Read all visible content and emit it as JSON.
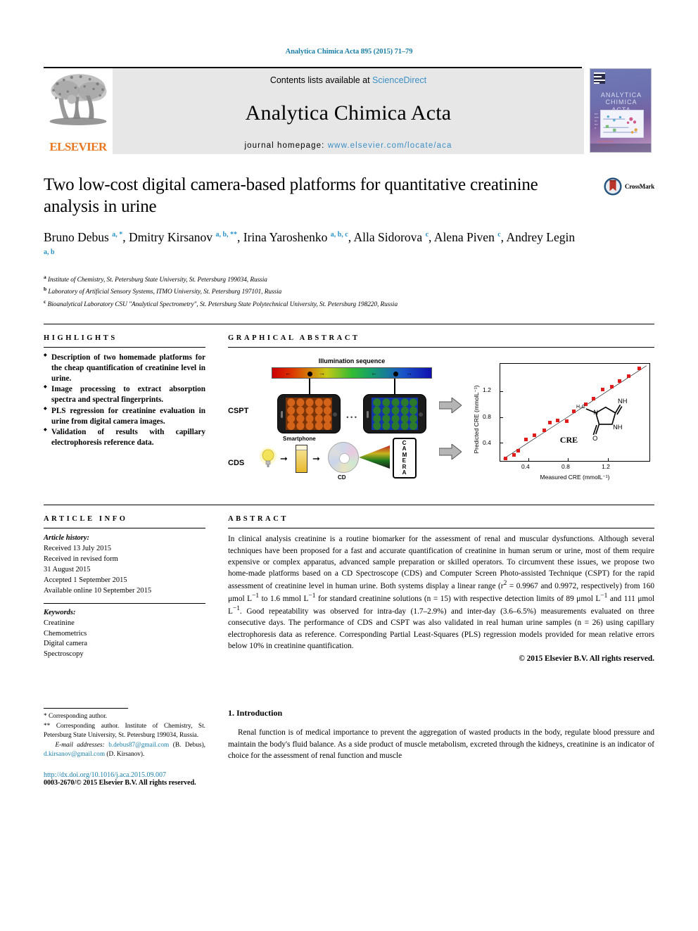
{
  "running_head": "Analytica Chimica Acta 895 (2015) 71–79",
  "masthead": {
    "contents_prefix": "Contents lists available at ",
    "sciencedirect": "ScienceDirect",
    "journal_name": "Analytica Chimica Acta",
    "homepage_prefix": "journal homepage: ",
    "homepage_url": "www.elsevier.com/locate/aca",
    "publisher": "ELSEVIER",
    "cover_title": "ANALYTICA CHIMICA ACTA",
    "accent_link_color": "#3c8fc4",
    "publisher_color": "#E87722"
  },
  "article": {
    "title": "Two low-cost digital camera-based platforms for quantitative creatinine analysis in urine",
    "crossmark_label": "CrossMark",
    "authors_html": "Bruno Debus <sup>a, *</sup>, Dmitry Kirsanov <sup>a, b, **</sup>, Irina Yaroshenko <sup>a, b, c</sup>, Alla Sidorova <sup>c</sup>, Alena Piven <sup>c</sup>, Andrey Legin <sup>a, b</sup>",
    "affiliations": [
      {
        "marker": "a",
        "text": "Institute of Chemistry, St. Petersburg State University, St. Petersburg 199034, Russia"
      },
      {
        "marker": "b",
        "text": "Laboratory of Artificial Sensory Systems, ITMO University, St. Petersburg 197101, Russia"
      },
      {
        "marker": "c",
        "text": "Bioanalytical Laboratory CSU \"Analytical Spectrometry\", St. Petersburg State Polytechnical University, St. Petersburg 198220, Russia"
      }
    ]
  },
  "highlights": {
    "heading": "HIGHLIGHTS",
    "items": [
      "Description of two homemade platforms for the cheap quantification of creatinine level in urine.",
      "Image processing to extract absorption spectra and spectral fingerprints.",
      "PLS regression for creatinine evaluation in urine from digital camera images.",
      "Validation of results with capillary electrophoresis reference data."
    ]
  },
  "graphical_abstract": {
    "heading": "GRAPHICAL ABSTRACT",
    "illumination_label": "Illumination sequence",
    "row_labels": {
      "cspt": "CSPT",
      "cds": "CDS"
    },
    "smartphone_caption": "Smartphone",
    "cd_caption": "CD",
    "camera_label": "CAMERA",
    "ellipsis": "...",
    "molecule_label": "CRE",
    "molecule_atoms": [
      "H₃C",
      "N",
      "NH",
      "NH",
      "O"
    ]
  },
  "chart_data": {
    "type": "scatter",
    "title": "",
    "xlabel": "Measured CRE (mmolL⁻¹)",
    "ylabel": "Predicted CRE (mmolL⁻¹)",
    "xticks": [
      0.4,
      0.8,
      1.2
    ],
    "yticks": [
      0.4,
      0.8,
      1.2
    ],
    "xlim": [
      0.12,
      1.62
    ],
    "ylim": [
      0.12,
      1.62
    ],
    "grid": false,
    "legend": "none",
    "marker_color": "#e01b1b",
    "line_color": "#000000",
    "fit_line": {
      "slope": 1.0,
      "intercept": 0.0
    },
    "points": [
      [
        0.17,
        0.16
      ],
      [
        0.26,
        0.22
      ],
      [
        0.3,
        0.28
      ],
      [
        0.38,
        0.45
      ],
      [
        0.46,
        0.52
      ],
      [
        0.56,
        0.6
      ],
      [
        0.62,
        0.72
      ],
      [
        0.7,
        0.75
      ],
      [
        0.79,
        0.74
      ],
      [
        0.86,
        0.89
      ],
      [
        0.98,
        1.0
      ],
      [
        1.06,
        1.09
      ],
      [
        1.15,
        1.23
      ],
      [
        1.24,
        1.27
      ],
      [
        1.32,
        1.36
      ],
      [
        1.41,
        1.43
      ],
      [
        1.52,
        1.55
      ]
    ]
  },
  "article_info": {
    "heading": "ARTICLE INFO",
    "history_label": "Article history:",
    "history": [
      "Received 13 July 2015",
      "Received in revised form",
      "31 August 2015",
      "Accepted 1 September 2015",
      "Available online 10 September 2015"
    ],
    "keywords_label": "Keywords:",
    "keywords": [
      "Creatinine",
      "Chemometrics",
      "Digital camera",
      "Spectroscopy"
    ]
  },
  "abstract": {
    "heading": "ABSTRACT",
    "body_html": "In clinical analysis creatinine is a routine biomarker for the assessment of renal and muscular dysfunctions. Although several techniques have been proposed for a fast and accurate quantification of creatinine in human serum or urine, most of them require expensive or complex apparatus, advanced sample preparation or skilled operators. To circumvent these issues, we propose two home-made platforms based on a CD Spectroscope (CDS) and Computer Screen Photo-assisted Technique (CSPT) for the rapid assessment of creatinine level in human urine. Both systems display a linear range (r<sup>2</sup> = 0.9967 and 0.9972, respectively) from 160 &mu;mol L<sup>&minus;1</sup> to 1.6 mmol L<sup>&minus;1</sup> for standard creatinine solutions (n = 15) with respective detection limits of 89 &mu;mol L<sup>&minus;1</sup> and 111 &mu;mol L<sup>&minus;1</sup>. Good repeatability was observed for intra-day (1.7&ndash;2.9%) and inter-day (3.6&ndash;6.5%) measurements evaluated on three consecutive days. The performance of CDS and CSPT was also validated in real human urine samples (n = 26) using capillary electrophoresis data as reference. Corresponding Partial Least-Squares (PLS) regression models provided for mean relative errors below 10% in creatinine quantification.",
    "copyright": "© 2015 Elsevier B.V. All rights reserved."
  },
  "footnotes": {
    "corresponding_1": "* Corresponding author.",
    "corresponding_2": "** Corresponding author. Institute of Chemistry, St. Petersburg State University, St. Petersburg 199034, Russia.",
    "email_label": "E-mail addresses:",
    "email_1": "b.debus87@gmail.com",
    "email_1_owner": "(B. Debus),",
    "email_2": "d.kirsanov@gmail.com",
    "email_2_owner": "(D. Kirsanov).",
    "doi": "http://dx.doi.org/10.1016/j.aca.2015.09.007",
    "issn_line": "0003-2670/© 2015 Elsevier B.V. All rights reserved."
  },
  "introduction": {
    "number_title": "1. Introduction",
    "paragraph": "Renal function is of medical importance to prevent the aggregation of wasted products in the body, regulate blood pressure and maintain the body's fluid balance. As a side product of muscle metabolism, excreted through the kidneys, creatinine is an indicator of choice for the assessment of renal function and muscle"
  }
}
